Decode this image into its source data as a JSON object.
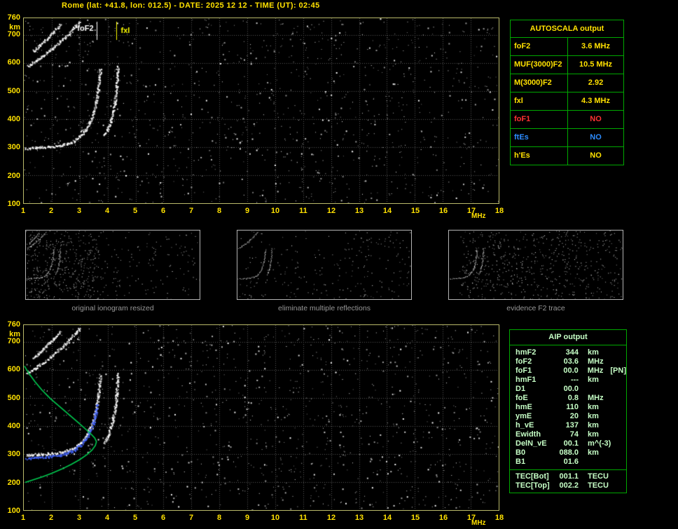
{
  "title": "Rome (lat: +41.8, lon: 012.5) - DATE: 2025 12 12 - TIME (UT): 02:45",
  "plots": {
    "x_range": [
      1,
      18
    ],
    "y_range": [
      100,
      760
    ],
    "x_ticks": [
      1,
      2,
      3,
      4,
      5,
      6,
      7,
      8,
      9,
      10,
      11,
      12,
      13,
      14,
      15,
      16,
      17,
      18
    ],
    "x_unit": "MHz",
    "y_ticks": [
      760,
      700,
      600,
      500,
      400,
      300,
      200,
      100
    ],
    "y_unit": "km"
  },
  "chart_data": [
    {
      "type": "scatter",
      "name": "measured ionogram",
      "xlabel": "MHz",
      "ylabel": "km",
      "x_range": [
        1,
        18
      ],
      "y_range": [
        100,
        760
      ],
      "grid": "on",
      "markers": [
        {
          "label": "foF2",
          "mhz": 3.62,
          "color": "#ffffff",
          "side": "left"
        },
        {
          "label": "fxl",
          "mhz": 4.3,
          "color": "#ffff00",
          "side": "right"
        }
      ],
      "traces": [
        {
          "name": "F2-multiple-reflection-o",
          "color": "#ffffff",
          "style": "dots",
          "points": [
            [
              1.12,
              590
            ],
            [
              1.4,
              607
            ],
            [
              1.7,
              628
            ],
            [
              2.0,
              652
            ],
            [
              2.3,
              678
            ],
            [
              2.6,
              706
            ],
            [
              2.85,
              733
            ],
            [
              2.97,
              748
            ]
          ]
        },
        {
          "name": "F2-multiple-reflection-x",
          "color": "#ffffff",
          "style": "dots",
          "points": [
            [
              1.32,
              642
            ],
            [
              1.55,
              663
            ],
            [
              1.8,
              687
            ],
            [
              2.05,
              712
            ],
            [
              2.28,
              737
            ]
          ]
        },
        {
          "name": "F2-ordinary-trace",
          "color": "#ffffff",
          "style": "dots",
          "points": [
            [
              1.08,
              297
            ],
            [
              1.5,
              300
            ],
            [
              1.9,
              302
            ],
            [
              2.25,
              306
            ],
            [
              2.55,
              313
            ],
            [
              2.8,
              324
            ],
            [
              3.0,
              340
            ],
            [
              3.2,
              362
            ],
            [
              3.35,
              390
            ],
            [
              3.48,
              424
            ],
            [
              3.58,
              462
            ],
            [
              3.65,
              505
            ],
            [
              3.7,
              548
            ],
            [
              3.73,
              582
            ]
          ]
        },
        {
          "name": "F2-extraordinary-trace",
          "color": "#ffffff",
          "style": "dots",
          "points": [
            [
              3.88,
              342
            ],
            [
              4.0,
              366
            ],
            [
              4.1,
              394
            ],
            [
              4.19,
              428
            ],
            [
              4.26,
              468
            ],
            [
              4.31,
              515
            ],
            [
              4.34,
              558
            ],
            [
              4.35,
              588
            ]
          ]
        }
      ]
    },
    {
      "type": "scatter",
      "name": "restored ionogram with autoscaled trace and electron density profile",
      "xlabel": "MHz",
      "ylabel": "km",
      "x_range": [
        1,
        18
      ],
      "y_range": [
        100,
        760
      ],
      "grid": "on",
      "traces": [
        {
          "name": "F2-multiple-reflection-o",
          "color": "#ffffff",
          "style": "dots",
          "points": [
            [
              1.12,
              590
            ],
            [
              1.4,
              607
            ],
            [
              1.7,
              628
            ],
            [
              2.0,
              652
            ],
            [
              2.3,
              678
            ],
            [
              2.6,
              706
            ],
            [
              2.85,
              733
            ],
            [
              2.97,
              748
            ]
          ]
        },
        {
          "name": "F2-multiple-reflection-x",
          "color": "#ffffff",
          "style": "dots",
          "points": [
            [
              1.32,
              642
            ],
            [
              1.55,
              663
            ],
            [
              1.8,
              687
            ],
            [
              2.05,
              712
            ],
            [
              2.28,
              737
            ]
          ]
        },
        {
          "name": "F2-ordinary-trace",
          "color": "#ffffff",
          "style": "dots",
          "points": [
            [
              1.08,
              297
            ],
            [
              1.5,
              300
            ],
            [
              1.9,
              302
            ],
            [
              2.25,
              306
            ],
            [
              2.55,
              313
            ],
            [
              2.8,
              324
            ],
            [
              3.0,
              340
            ],
            [
              3.2,
              362
            ],
            [
              3.35,
              390
            ],
            [
              3.48,
              424
            ],
            [
              3.58,
              462
            ],
            [
              3.65,
              505
            ],
            [
              3.7,
              548
            ],
            [
              3.73,
              582
            ]
          ]
        },
        {
          "name": "F2-extraordinary-trace",
          "color": "#ffffff",
          "style": "dots",
          "points": [
            [
              3.88,
              342
            ],
            [
              4.0,
              366
            ],
            [
              4.1,
              394
            ],
            [
              4.19,
              428
            ],
            [
              4.26,
              468
            ],
            [
              4.31,
              515
            ],
            [
              4.34,
              558
            ],
            [
              4.35,
              588
            ]
          ]
        },
        {
          "name": "autoscaled-trace",
          "color": "#4466ff",
          "style": "dots",
          "points": [
            [
              1.08,
              286
            ],
            [
              1.5,
              289
            ],
            [
              1.9,
              292
            ],
            [
              2.25,
              297
            ],
            [
              2.55,
              305
            ],
            [
              2.8,
              316
            ],
            [
              3.0,
              331
            ],
            [
              3.2,
              352
            ],
            [
              3.35,
              378
            ],
            [
              3.47,
              410
            ],
            [
              3.56,
              445
            ],
            [
              3.62,
              480
            ]
          ]
        },
        {
          "name": "electron-density-profile",
          "color": "#00cc50",
          "style": "line",
          "points": [
            [
              1.02,
              614
            ],
            [
              1.18,
              588
            ],
            [
              1.4,
              558
            ],
            [
              1.65,
              528
            ],
            [
              1.95,
              498
            ],
            [
              2.3,
              468
            ],
            [
              2.65,
              438
            ],
            [
              2.95,
              412
            ],
            [
              3.2,
              390
            ],
            [
              3.4,
              372
            ],
            [
              3.54,
              357
            ],
            [
              3.6,
              344
            ],
            [
              3.56,
              330
            ],
            [
              3.44,
              314
            ],
            [
              3.25,
              297
            ],
            [
              3.0,
              280
            ],
            [
              2.7,
              263
            ],
            [
              2.35,
              246
            ],
            [
              2.0,
              231
            ],
            [
              1.65,
              218
            ],
            [
              1.3,
              207
            ],
            [
              1.05,
              199
            ]
          ]
        }
      ]
    }
  ],
  "thumbnails": [
    {
      "caption": "original ionogram resized"
    },
    {
      "caption": "eliminate multiple reflections"
    },
    {
      "caption": "evidence F2 trace"
    }
  ],
  "autoscala_table": {
    "header": "AUTOSCALA output",
    "rows": [
      {
        "label": "foF2",
        "value": "3.6 MHz",
        "color": "#ffe100"
      },
      {
        "label": "MUF(3000)F2",
        "value": "10.5 MHz",
        "color": "#ffe100"
      },
      {
        "label": "M(3000)F2",
        "value": "2.92",
        "color": "#ffe100"
      },
      {
        "label": "fxl",
        "value": "4.3 MHz",
        "color": "#ffe100"
      },
      {
        "label": "foF1",
        "value": "NO",
        "color": "#ff3232"
      },
      {
        "label": "ftEs",
        "value": "NO",
        "color": "#2d8cff"
      },
      {
        "label": "h'Es",
        "value": "NO",
        "color": "#ffe100"
      }
    ]
  },
  "aip_table": {
    "header": "AIP output",
    "rows": [
      {
        "label": "hmF2",
        "value": "344",
        "unit": "km",
        "note": ""
      },
      {
        "label": "foF2",
        "value": "03.6",
        "unit": "MHz",
        "note": ""
      },
      {
        "label": "foF1",
        "value": "00.0",
        "unit": "MHz",
        "note": "[PN]"
      },
      {
        "label": "hmF1",
        "value": "---",
        "unit": "km",
        "note": ""
      },
      {
        "label": "D1",
        "value": "00.0",
        "unit": "",
        "note": ""
      },
      {
        "label": "foE",
        "value": "0.8",
        "unit": "MHz",
        "note": ""
      },
      {
        "label": "hmE",
        "value": "110",
        "unit": "km",
        "note": ""
      },
      {
        "label": "ymE",
        "value": "20",
        "unit": "km",
        "note": ""
      },
      {
        "label": "h_vE",
        "value": "137",
        "unit": "km",
        "note": ""
      },
      {
        "label": "Ewidth",
        "value": "74",
        "unit": "km",
        "note": ""
      },
      {
        "label": "DelN_vE",
        "value": "00.1",
        "unit": "m^(-3)",
        "note": ""
      },
      {
        "label": "B0",
        "value": "088.0",
        "unit": "km",
        "note": ""
      },
      {
        "label": "B1",
        "value": "01.6",
        "unit": "",
        "note": ""
      }
    ],
    "tec_rows": [
      {
        "label": "TEC[Bot]",
        "value": "001.1",
        "unit": "TECU"
      },
      {
        "label": "TEC[Top]",
        "value": "002.2",
        "unit": "TECU"
      }
    ]
  }
}
